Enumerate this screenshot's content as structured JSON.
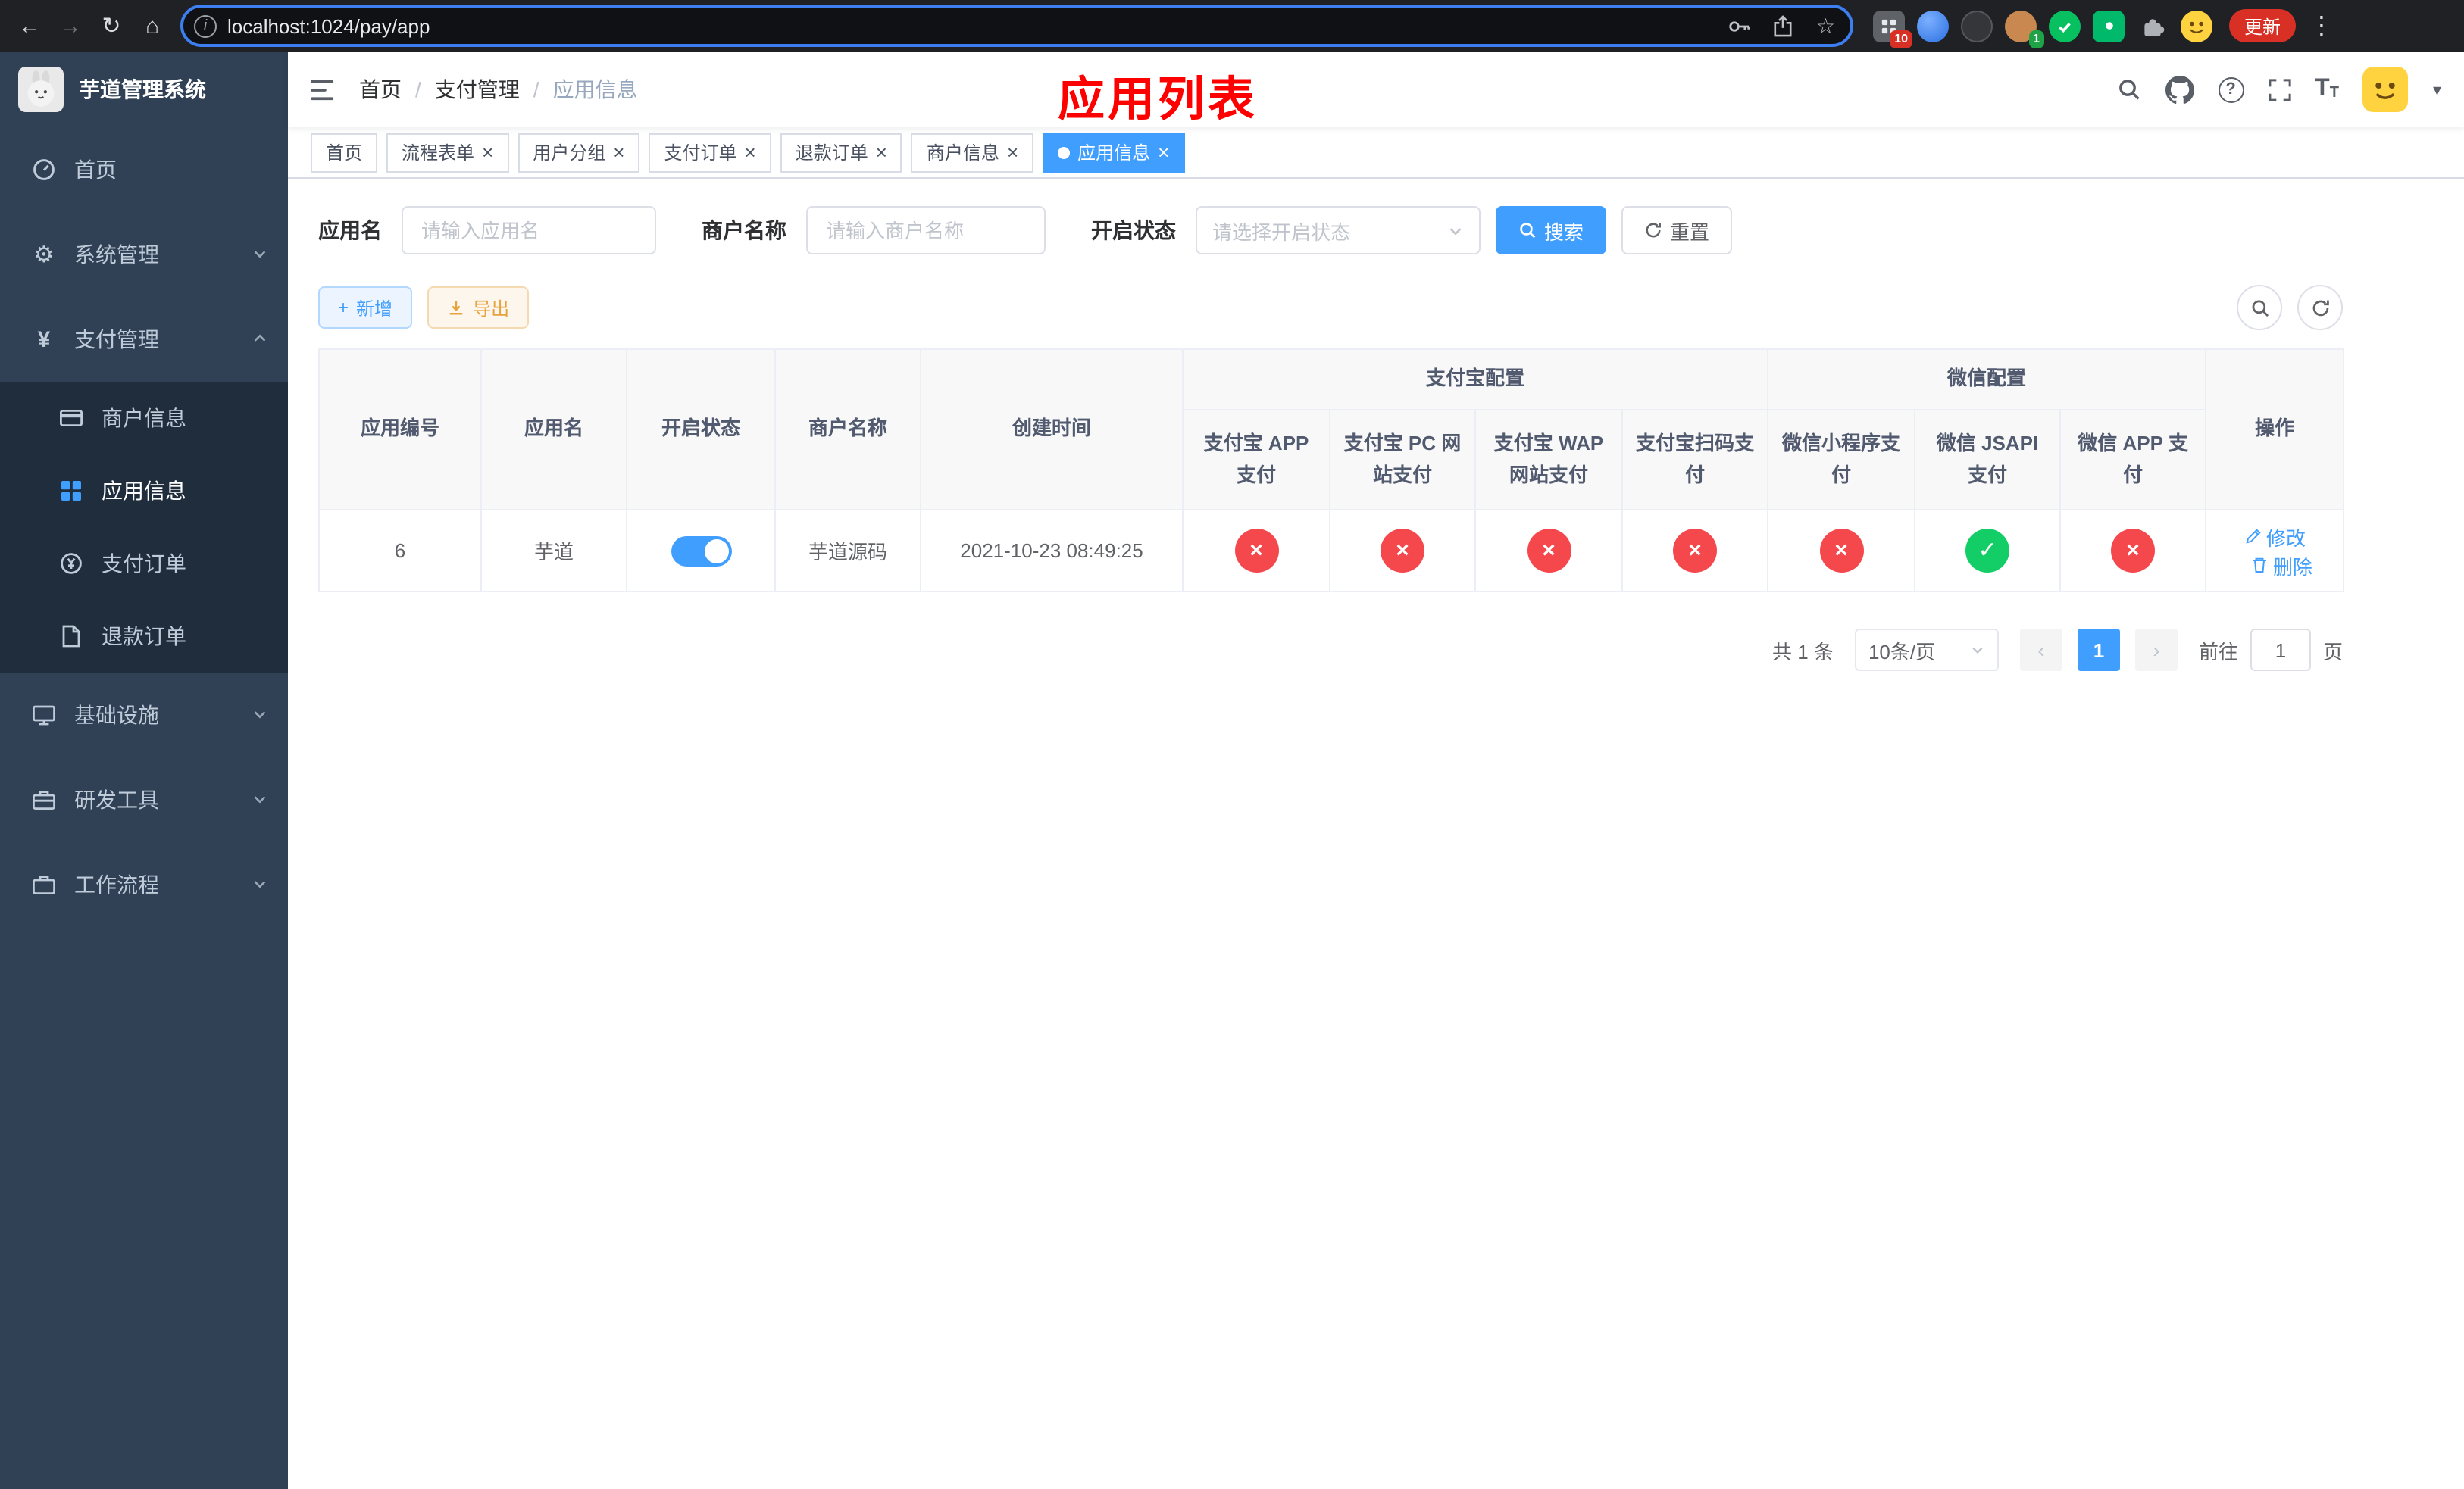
{
  "browser": {
    "url": "localhost:1024/pay/app",
    "update_button": "更新",
    "extension_badge_count": "10",
    "profile_badge_count": "1"
  },
  "icons": {
    "back": "←",
    "forward": "→",
    "reload": "↻",
    "home": "⌂",
    "star": "☆",
    "menu": "⋮",
    "info": "i",
    "question": "?",
    "plus": "+",
    "yen": "¥",
    "gear": "⚙",
    "caret_down": "▾",
    "close": "×",
    "check": "✓",
    "cross": "×",
    "prev": "‹",
    "next": "›"
  },
  "colors": {
    "accent": "#409eff",
    "success": "#13ce66",
    "danger": "#f5484d",
    "sidebar_bg": "#304156",
    "submenu_bg": "#1f2d3d"
  },
  "sidebar": {
    "app_title": "芋道管理系统",
    "items": [
      {
        "label": "首页"
      },
      {
        "label": "系统管理"
      },
      {
        "label": "支付管理"
      },
      {
        "label": "基础设施"
      },
      {
        "label": "研发工具"
      },
      {
        "label": "工作流程"
      }
    ],
    "payment_children": [
      {
        "label": "商户信息"
      },
      {
        "label": "应用信息"
      },
      {
        "label": "支付订单"
      },
      {
        "label": "退款订单"
      }
    ]
  },
  "navbar": {
    "breadcrumb": {
      "home": "首页",
      "section": "支付管理",
      "current": "应用信息",
      "separator": "/"
    }
  },
  "overlay": {
    "title": "应用列表"
  },
  "tabs": [
    {
      "label": "首页"
    },
    {
      "label": "流程表单"
    },
    {
      "label": "用户分组"
    },
    {
      "label": "支付订单"
    },
    {
      "label": "退款订单"
    },
    {
      "label": "商户信息"
    },
    {
      "label": "应用信息"
    }
  ],
  "filters": {
    "app_name": {
      "label": "应用名",
      "placeholder": "请输入应用名",
      "value": ""
    },
    "merchant_name": {
      "label": "商户名称",
      "placeholder": "请输入商户名称",
      "value": ""
    },
    "status": {
      "label": "开启状态",
      "placeholder": "请选择开启状态"
    },
    "search_button": "搜索",
    "reset_button": "重置"
  },
  "toolbar": {
    "add_button": "新增",
    "export_button": "导出"
  },
  "table": {
    "headers": {
      "app_id": "应用编号",
      "app_name": "应用名",
      "status": "开启状态",
      "merchant": "商户名称",
      "created": "创建时间",
      "alipay_group": "支付宝配置",
      "wechat_group": "微信配置",
      "alipay_app": "支付宝 APP 支付",
      "alipay_pc": "支付宝 PC 网站支付",
      "alipay_wap": "支付宝 WAP 网站支付",
      "alipay_qr": "支付宝扫码支付",
      "wechat_mini": "微信小程序支付",
      "wechat_jsapi": "微信 JSAPI 支付",
      "wechat_app": "微信 APP 支付",
      "actions": "操作"
    },
    "rows": [
      {
        "app_id": "6",
        "app_name": "芋道",
        "enabled": true,
        "merchant": "芋道源码",
        "created": "2021-10-23 08:49:25",
        "alipay_app": false,
        "alipay_pc": false,
        "alipay_wap": false,
        "alipay_qr": false,
        "wechat_mini": false,
        "wechat_jsapi": true,
        "wechat_app": false,
        "edit_label": "修改",
        "delete_label": "删除"
      }
    ]
  },
  "pagination": {
    "total_text": "共 1 条",
    "page_size_text": "10条/页",
    "current_page": "1",
    "goto_prefix": "前往",
    "goto_value": "1",
    "goto_suffix": "页"
  }
}
